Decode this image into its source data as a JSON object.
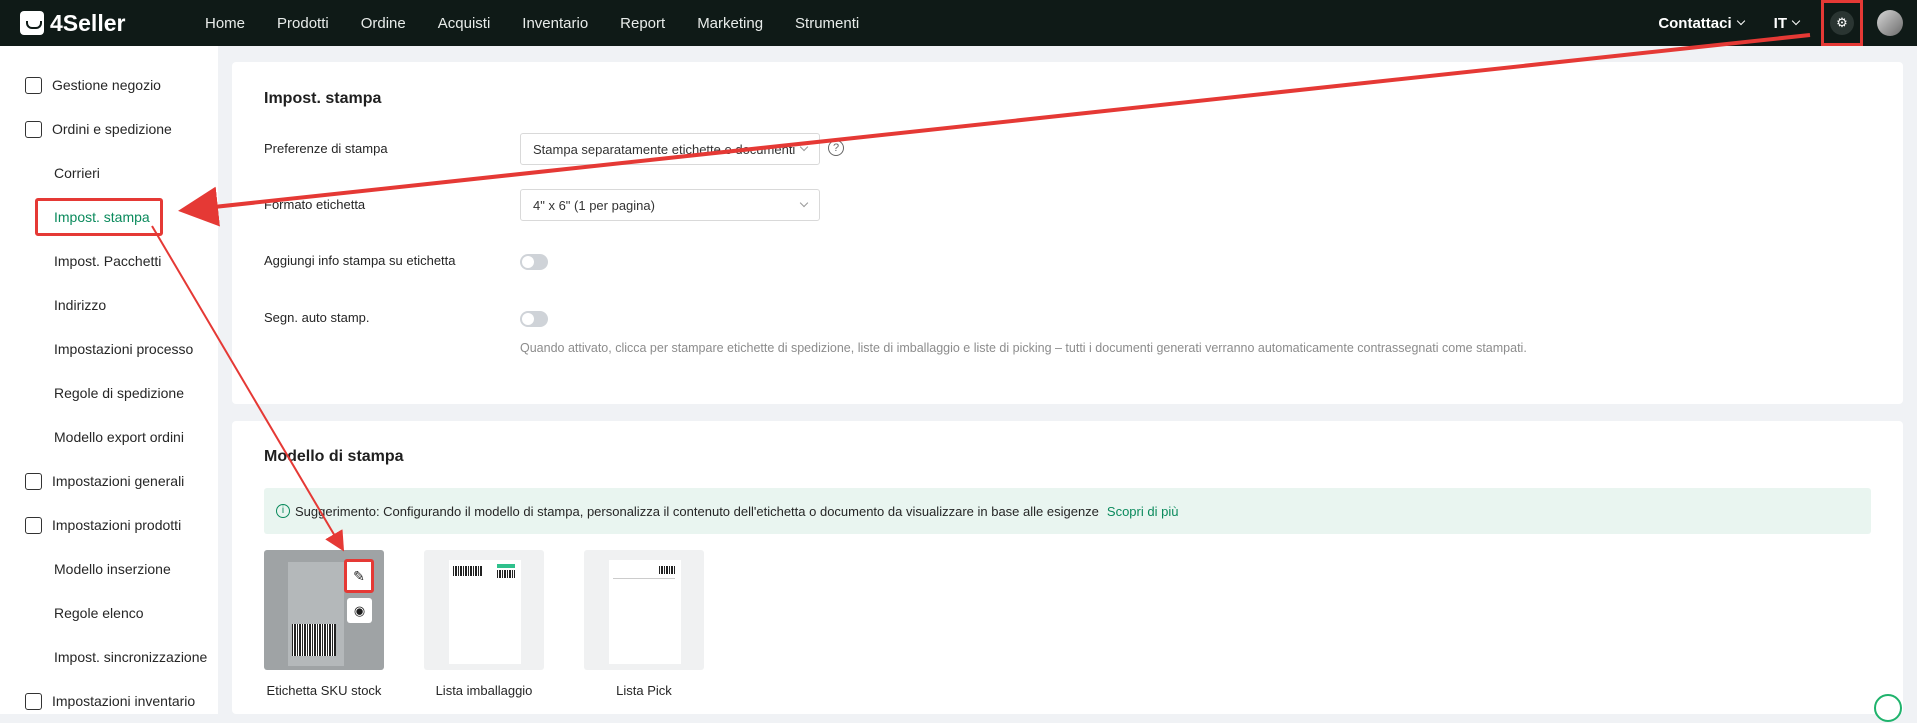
{
  "app": {
    "name": "4Seller"
  },
  "nav": {
    "items": [
      "Home",
      "Prodotti",
      "Ordine",
      "Acquisti",
      "Inventario",
      "Report",
      "Marketing",
      "Strumenti"
    ]
  },
  "topright": {
    "contact": "Contattaci",
    "lang": "IT"
  },
  "sidebar": {
    "items": [
      {
        "label": "Gestione negozio"
      },
      {
        "label": "Ordini e spedizione"
      },
      {
        "label": "Corrieri"
      },
      {
        "label": "Impost. stampa"
      },
      {
        "label": "Impost. Pacchetti"
      },
      {
        "label": "Indirizzo"
      },
      {
        "label": "Impostazioni processo"
      },
      {
        "label": "Regole di spedizione"
      },
      {
        "label": "Modello export ordini"
      },
      {
        "label": "Impostazioni generali"
      },
      {
        "label": "Impostazioni prodotti"
      },
      {
        "label": "Modello inserzione"
      },
      {
        "label": "Regole elenco"
      },
      {
        "label": "Impost. sincronizzazione"
      },
      {
        "label": "Impostazioni inventario"
      }
    ]
  },
  "print_settings": {
    "title": "Impost. stampa",
    "pref_label": "Preferenze di stampa",
    "pref_value": "Stampa separatamente etichette e documenti",
    "format_label": "Formato etichetta",
    "format_value": "4\" x 6\" (1 per pagina)",
    "info_label": "Aggiungi info stampa su etichetta",
    "info_enabled": false,
    "auto_label": "Segn. auto stamp.",
    "auto_enabled": false,
    "auto_hint": "Quando attivato, clicca per stampare etichette di spedizione, liste di imballaggio e liste di picking – tutti i documenti generati verranno automaticamente contrassegnati come stampati."
  },
  "templates": {
    "title": "Modello di stampa",
    "tip": "Suggerimento: Configurando il modello di stampa, personalizza il contenuto dell'etichetta o documento da visualizzare in base alle esigenze",
    "tip_link": "Scopri di più",
    "items": [
      {
        "name": "Etichetta SKU stock"
      },
      {
        "name": "Lista imballaggio"
      },
      {
        "name": "Lista Pick"
      }
    ]
  },
  "colors": {
    "topbar": "#0f1a17",
    "accent": "#0a8a5c",
    "highlight": "#e53935"
  },
  "icons": {
    "settings": "gear-icon",
    "edit": "edit-icon",
    "view": "eye-icon",
    "help": "question-icon",
    "info": "info-icon"
  }
}
